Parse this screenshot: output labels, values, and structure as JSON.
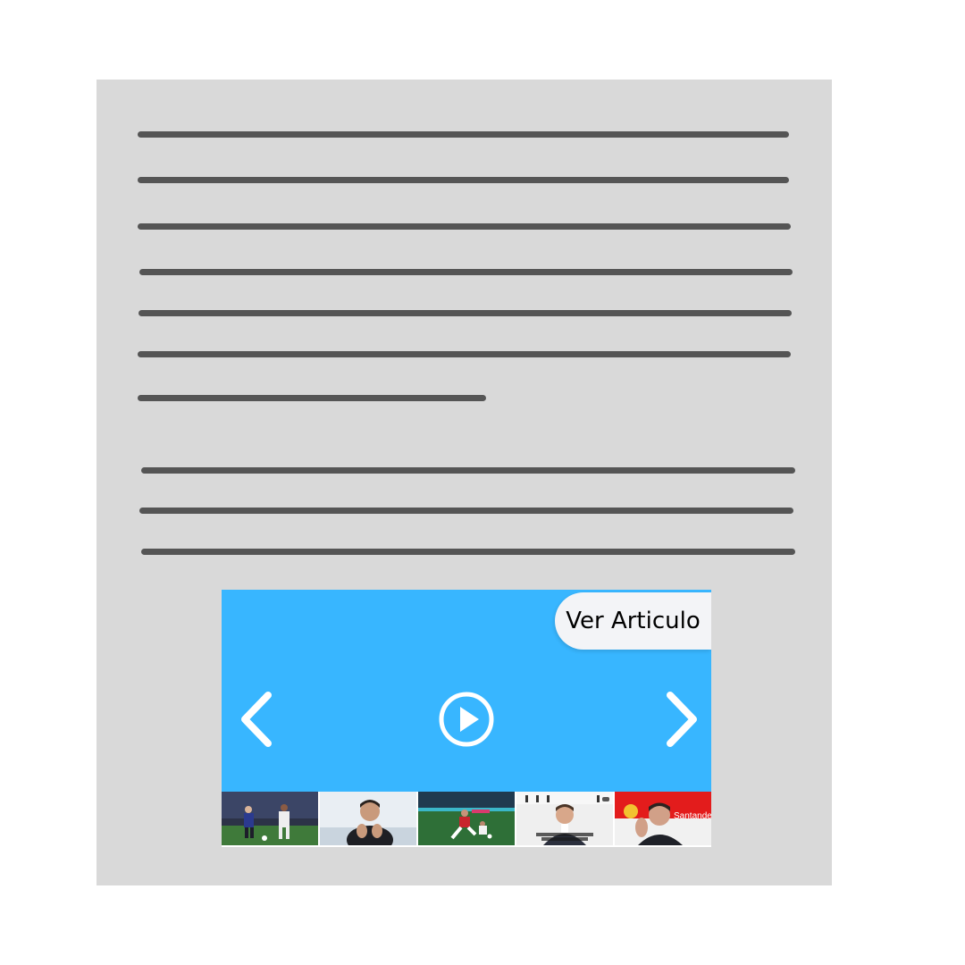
{
  "article": {
    "line_count": 10
  },
  "player": {
    "view_article_label": "Ver Articulo",
    "prev_icon": "chevron-left-icon",
    "play_icon": "play-circle-icon",
    "next_icon": "chevron-right-icon",
    "accent_color": "#38b6ff"
  },
  "thumbnails": [
    {
      "name": "thumbnail-football-match-1"
    },
    {
      "name": "thumbnail-coach-clapping"
    },
    {
      "name": "thumbnail-football-match-2"
    },
    {
      "name": "thumbnail-press-interview"
    },
    {
      "name": "thumbnail-coach-sponsor-board"
    }
  ],
  "thumbnail_captions": {
    "sponsor_text": "Santander"
  }
}
